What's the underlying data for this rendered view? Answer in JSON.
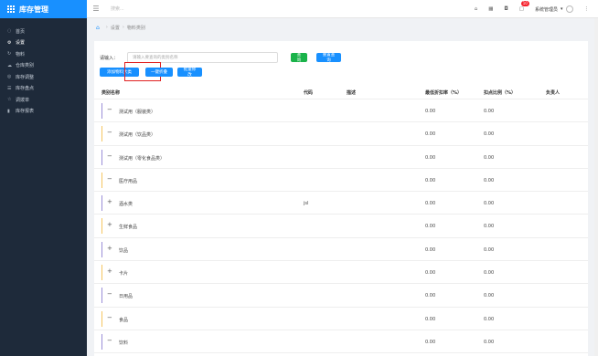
{
  "app": {
    "title": "库存管理"
  },
  "sidebar": {
    "items": [
      {
        "label": "首页",
        "icon": "◌"
      },
      {
        "label": "设置",
        "icon": "⚙"
      },
      {
        "label": "物料",
        "icon": "↻"
      },
      {
        "label": "仓库类别",
        "icon": "☁"
      },
      {
        "label": "库存调整",
        "icon": "◎"
      },
      {
        "label": "库存盘点",
        "icon": "☰"
      },
      {
        "label": "调拨单",
        "icon": "☆"
      },
      {
        "label": "库存报表",
        "icon": "▮"
      }
    ],
    "active_index": 1
  },
  "topbar": {
    "search_placeholder": "搜索...",
    "notification_count": "10",
    "user_name": "系统管理员"
  },
  "breadcrumb": {
    "items": [
      "设置",
      "物料类别"
    ]
  },
  "filter": {
    "label": "请输入：",
    "placeholder": "请输入要查询的类别名称",
    "query_button": "查询",
    "reset_button": "重置查询"
  },
  "actions": {
    "add_top_category": "添加物料大类",
    "collapse_all": "一键折叠",
    "batch_edit": "批量修改"
  },
  "table": {
    "headers": {
      "name": "类别名称",
      "code": "代码",
      "desc": "描述",
      "rate": "最低折扣率（%）",
      "ratio": "扣点比例（%）",
      "owner": "负责人"
    },
    "rows": [
      {
        "toggle": "−",
        "name": "测试用（服装类）",
        "code": "",
        "rate": "0.00",
        "ratio": "0.00",
        "bar_color": "#9b8fd8"
      },
      {
        "toggle": "−",
        "name": "测试用（饮品类）",
        "code": "",
        "rate": "0.00",
        "ratio": "0.00",
        "bar_color": "#f5c561"
      },
      {
        "toggle": "−",
        "name": "测试用（零化食品类）",
        "code": "",
        "rate": "0.00",
        "ratio": "0.00",
        "bar_color": "#9b8fd8"
      },
      {
        "toggle": "−",
        "name": "医疗用品",
        "code": "",
        "rate": "0.00",
        "ratio": "0.00",
        "bar_color": "#f5c561"
      },
      {
        "toggle": "+",
        "name": "酒水类",
        "code": "jsl",
        "rate": "0.00",
        "ratio": "0.00",
        "bar_color": "#9b8fd8"
      },
      {
        "toggle": "+",
        "name": "生鲜食品",
        "code": "",
        "rate": "0.00",
        "ratio": "0.00",
        "bar_color": "#f5c561"
      },
      {
        "toggle": "+",
        "name": "饮品",
        "code": "",
        "rate": "0.00",
        "ratio": "0.00",
        "bar_color": "#9b8fd8"
      },
      {
        "toggle": "+",
        "name": "卡片",
        "code": "",
        "rate": "0.00",
        "ratio": "0.00",
        "bar_color": "#f5c561"
      },
      {
        "toggle": "−",
        "name": "日用品",
        "code": "",
        "rate": "0.00",
        "ratio": "0.00",
        "bar_color": "#9b8fd8"
      },
      {
        "toggle": "−",
        "name": "食品",
        "code": "",
        "rate": "0.00",
        "ratio": "0.00",
        "bar_color": "#f5c561"
      },
      {
        "toggle": "−",
        "name": "饮料",
        "code": "",
        "rate": "0.00",
        "ratio": "0.00",
        "bar_color": "#9b8fd8"
      }
    ]
  },
  "colors": {
    "brand": "#1890ff",
    "sidebar_bg": "#1e2a3a",
    "query_green": "#1ab34a",
    "highlight_red": "#e02020"
  }
}
